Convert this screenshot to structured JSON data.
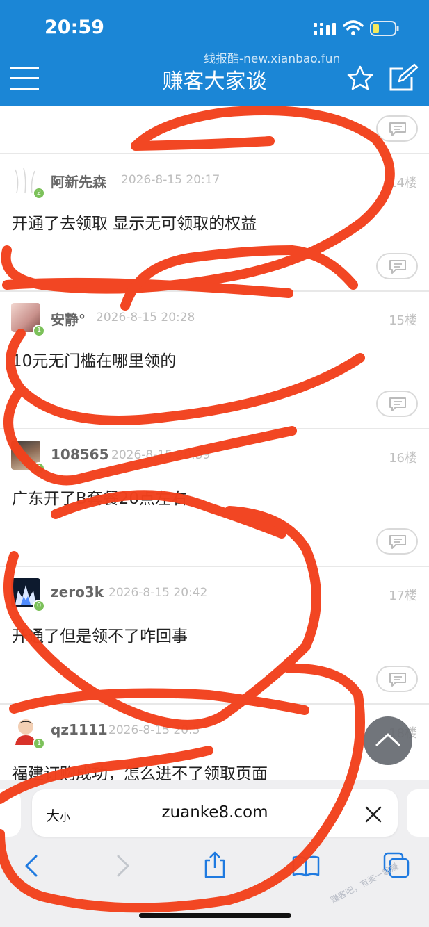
{
  "status_bar": {
    "time": "20:59"
  },
  "watermark": "线报酷-new.xianbao.fun",
  "nav": {
    "title": "赚客大家谈"
  },
  "posts": [
    {
      "username": "阿新先森",
      "level": "2",
      "date": "2026-8-15 20:17",
      "floor": "14楼",
      "content": "开通了去领取 显示无可领取的权益"
    },
    {
      "username": "安静°",
      "level": "1",
      "date": "2026-8-15 20:28",
      "floor": "15楼",
      "content": "10元无门槛在哪里领的"
    },
    {
      "username": "108565",
      "level": "2",
      "date": "2026-8-15 20:39",
      "floor": "16楼",
      "content": "广东开了B套餐20点左右"
    },
    {
      "username": "zero3k",
      "level": "0",
      "date": "2026-8-15 20:42",
      "floor": "17楼",
      "content": "开通了但是领不了咋回事"
    },
    {
      "username": "qz1111",
      "level": "1",
      "date": "2026-8-15 20:5",
      "floor": "18楼",
      "content": "福建订购成功，怎么进不了领取页面"
    }
  ],
  "browser": {
    "text_size_label": "大",
    "text_size_small": "小",
    "url": "zuanke8.com"
  },
  "corner_watermark": "赚客吧，有奖一起赚",
  "colors": {
    "brand_blue": "#1b86d6",
    "annotation_red": "#f2411c",
    "level_green": "#7cc15a"
  }
}
